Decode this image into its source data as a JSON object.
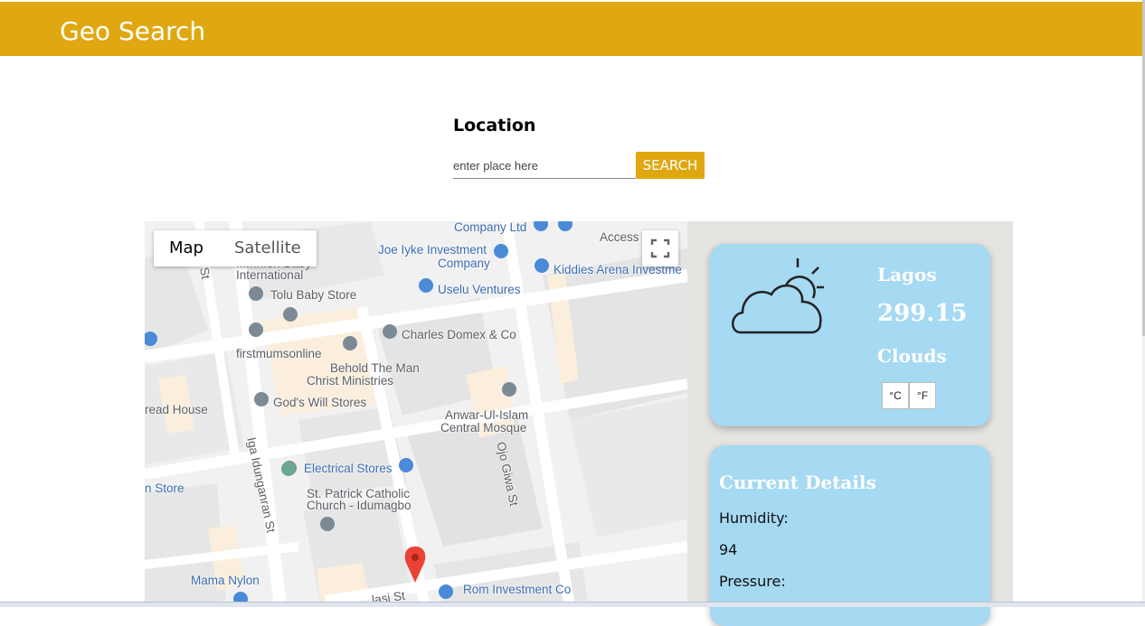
{
  "app": {
    "brand": "Geo Search",
    "brand_color": "#DFA811"
  },
  "search": {
    "title": "Location",
    "placeholder": "enter place here",
    "value": "",
    "button_label": "SEARCH"
  },
  "map": {
    "type_options": [
      "Map",
      "Satellite"
    ],
    "selected_type": "Map",
    "fullscreen_icon": "fullscreen-icon",
    "labels": {
      "company_ltd": "Company Ltd",
      "access": "Access",
      "joe_iyke_1": "Joe Iyke Investment",
      "joe_iyke_2": "Company",
      "kiddies": "Kiddies Arena Investme",
      "baby_1": "...mmon Baby",
      "baby_2": "International",
      "tolu": "Tolu Baby Store",
      "uselu": "Uselu Ventures",
      "charles": "Charles Domex & Co",
      "firstmums": "firstmumsonline",
      "behold_1": "Behold The Man",
      "behold_2": "Christ Ministries",
      "gods_will": "God's Will Stores",
      "bread_house": "read House",
      "anwar_1": "Anwar-Ul-Islam",
      "anwar_2": "Central Mosque",
      "ojo_giwa": "Ojo Giwa St",
      "iga": "Iga Idunganran St",
      "electrical": "Electrical Stores",
      "n_store": "n Store",
      "patrick_1": "St. Patrick Catholic",
      "patrick_2": "Church - Idumagbo",
      "mama_nylon": "Mama Nylon",
      "alasi": "...lasi St",
      "rom": "Rom Investment Co",
      "st": "St"
    }
  },
  "weather": {
    "city": "Lagos",
    "temperature": "299.15",
    "condition": "Clouds",
    "icon": "partly-cloudy-icon",
    "units": [
      "°C",
      "°F"
    ]
  },
  "details": {
    "title": "Current Details",
    "humidity_label": "Humidity:",
    "humidity_value": "94",
    "pressure_label": "Pressure:"
  }
}
